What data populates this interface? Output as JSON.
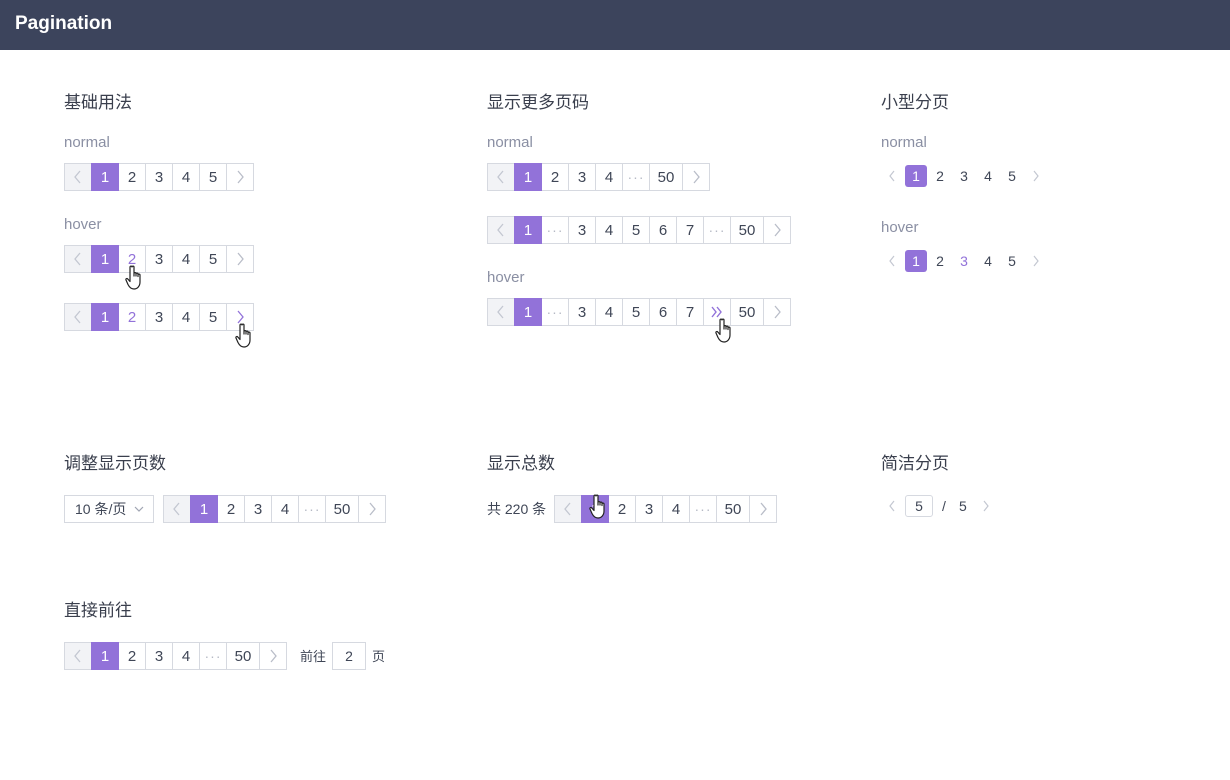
{
  "header": {
    "title": "Pagination"
  },
  "sections": {
    "basic": {
      "title": "基础用法",
      "label_normal": "normal",
      "label_hover": "hover"
    },
    "more": {
      "title": "显示更多页码",
      "label_normal": "normal",
      "label_hover": "hover"
    },
    "small": {
      "title": "小型分页",
      "label_normal": "normal",
      "label_hover": "hover"
    },
    "size": {
      "title": "调整显示页数",
      "select_value": "10 条/页"
    },
    "total": {
      "title": "显示总数",
      "total_text": "共 220 条"
    },
    "simple": {
      "title": "简洁分页",
      "current": "5",
      "separator": "/",
      "total_pages": "5"
    },
    "jump": {
      "title": "直接前往",
      "goto_label": "前往",
      "goto_value": "2",
      "page_suffix": "页"
    }
  },
  "pages": {
    "p1": "1",
    "p2": "2",
    "p3": "3",
    "p4": "4",
    "p5": "5",
    "p6": "6",
    "p7": "7",
    "p50": "50",
    "dots": "···"
  },
  "icons": {
    "prev": "chevron-left-icon",
    "next": "chevron-right-icon",
    "dots": "ellipsis-icon",
    "fast_forward": "double-chevron-right-icon",
    "cursor": "hand-pointer-icon",
    "dropdown": "chevron-down-icon"
  },
  "colors": {
    "accent": "#9272d9",
    "header_bg": "#3c445c",
    "border": "#d6d9e0",
    "disabled_bg": "#f2f3f6",
    "muted_text": "#8a8fa3"
  }
}
